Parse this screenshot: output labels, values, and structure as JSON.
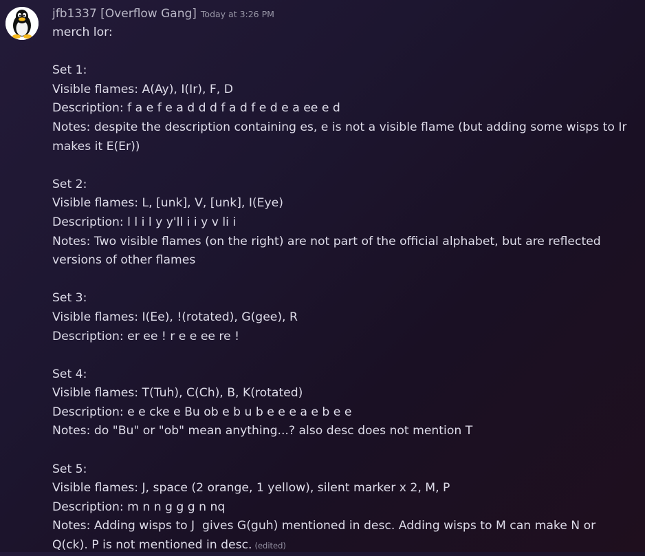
{
  "message": {
    "author": "jfb1337 [Overflow Gang]",
    "timestamp": "Today at 3:26 PM",
    "avatar_icon": "penguin-avatar-icon",
    "lines": [
      "merch lor:",
      "",
      "Set 1:",
      "Visible flames: A(Ay), I(Ir), F, D",
      "Description: f a e f e a d d d f a d f e d e a ee e d",
      "Notes: despite the description containing es, e is not a visible flame (but adding some wisps to Ir makes it E(Er))",
      "",
      "Set 2:",
      "Visible flames: L, [unk], V, [unk], I(Eye)",
      "Description: l l i l y y'll i i y v li i",
      "Notes: Two visible flames (on the right) are not part of the official alphabet, but are reflected versions of other flames",
      "",
      "Set 3:",
      "Visible flames: I(Ee), !(rotated), G(gee), R",
      "Description: er ee ! r e e ee re !",
      "",
      "Set 4:",
      "Visible flames: T(Tuh), C(Ch), B, K(rotated)",
      "Description: e e cke e Bu ob e b u b e e e a e b e e",
      "Notes: do \"Bu\" or \"ob\" mean anything...? also desc does not mention T",
      "",
      "Set 5:",
      "Visible flames: J, space (2 orange, 1 yellow), silent marker x 2, M, P",
      "Description: m n n g g g n nq",
      "Notes: Adding wisps to J  gives G(guh) mentioned in desc. Adding wisps to M can make N or Q(ck). P is not mentioned in desc."
    ],
    "edited_label": "(edited)"
  }
}
